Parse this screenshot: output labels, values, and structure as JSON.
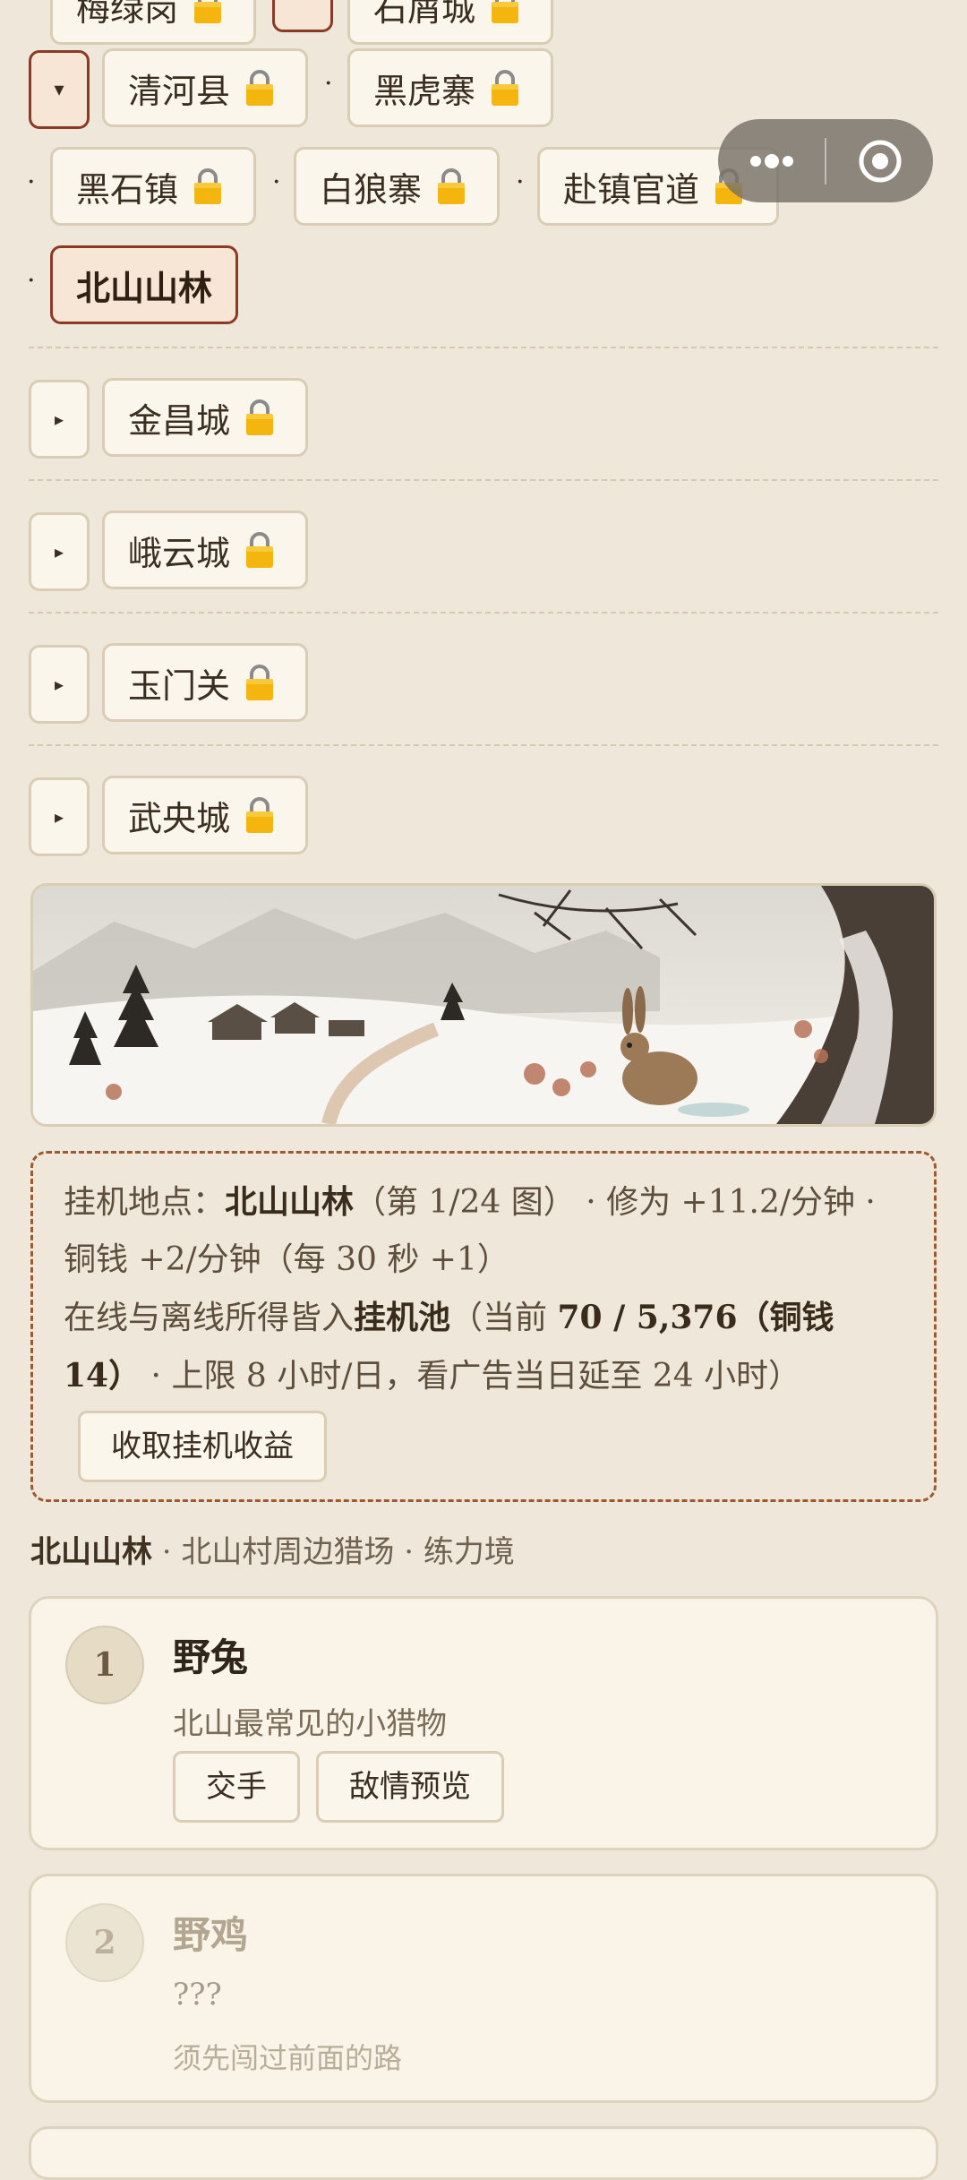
{
  "map_tree": {
    "partial_row": {
      "chips": [
        {
          "label": "梅绿岗",
          "locked": true
        },
        {
          "label": "石屑城",
          "locked": true
        }
      ]
    },
    "expanded_group": {
      "toggle": "▾",
      "rows": [
        [
          {
            "label": "清河县",
            "locked": true
          },
          {
            "label": "黑虎寨",
            "locked": true
          }
        ],
        [
          {
            "label": "黑石镇",
            "locked": true
          },
          {
            "label": "白狼寨",
            "locked": true
          },
          {
            "label": "赴镇官道",
            "locked": true
          }
        ],
        [
          {
            "label": "北山山林",
            "locked": false,
            "current": true
          }
        ]
      ]
    },
    "collapsed_groups": [
      {
        "toggle": "▸",
        "label": "金昌城",
        "locked": true
      },
      {
        "toggle": "▸",
        "label": "峨云城",
        "locked": true
      },
      {
        "toggle": "▸",
        "label": "玉门关",
        "locked": true
      },
      {
        "toggle": "▸",
        "label": "武央城",
        "locked": true
      }
    ],
    "separator": "·"
  },
  "mini_program_capsule": {
    "more_icon": "more-dots-icon",
    "close_icon": "target-circle-icon"
  },
  "scene": {
    "description_icon": "snowy-mountain-rabbit-painting"
  },
  "idle": {
    "line1_prefix": "挂机地点：",
    "location": "北山山林",
    "line1_map": "（第 1/24 图）",
    "line1_rates": " · 修为 +11.2/分钟 · 铜钱 +2/分钟（每 30 秒 +1）",
    "line2_prefix": "在线与离线所得皆入",
    "pool_label": "挂机池",
    "pool_open": "（当前 ",
    "pool_value": "70 / 5,376（铜钱 14）",
    "line2_suffix": " · 上限 8 小时/日，看广告当日延至 24 小时）",
    "claim_button": "收取挂机收益"
  },
  "region": {
    "name": "北山山林",
    "info": " · 北山村周边猎场 · 练力境"
  },
  "enemies": [
    {
      "index": "1",
      "name": "野兔",
      "desc": "北山最常见的小猎物",
      "fight": "交手",
      "preview": "敌情预览",
      "locked": false
    },
    {
      "index": "2",
      "name": "野鸡",
      "desc": "???",
      "lock_msg": "须先闯过前面的路",
      "locked": true
    }
  ],
  "colors": {
    "background": "#efe8da",
    "accent_border": "#8b3a25",
    "idle_border": "#9c5a33",
    "card": "#faf4e8",
    "lock": "#f5b50f"
  }
}
